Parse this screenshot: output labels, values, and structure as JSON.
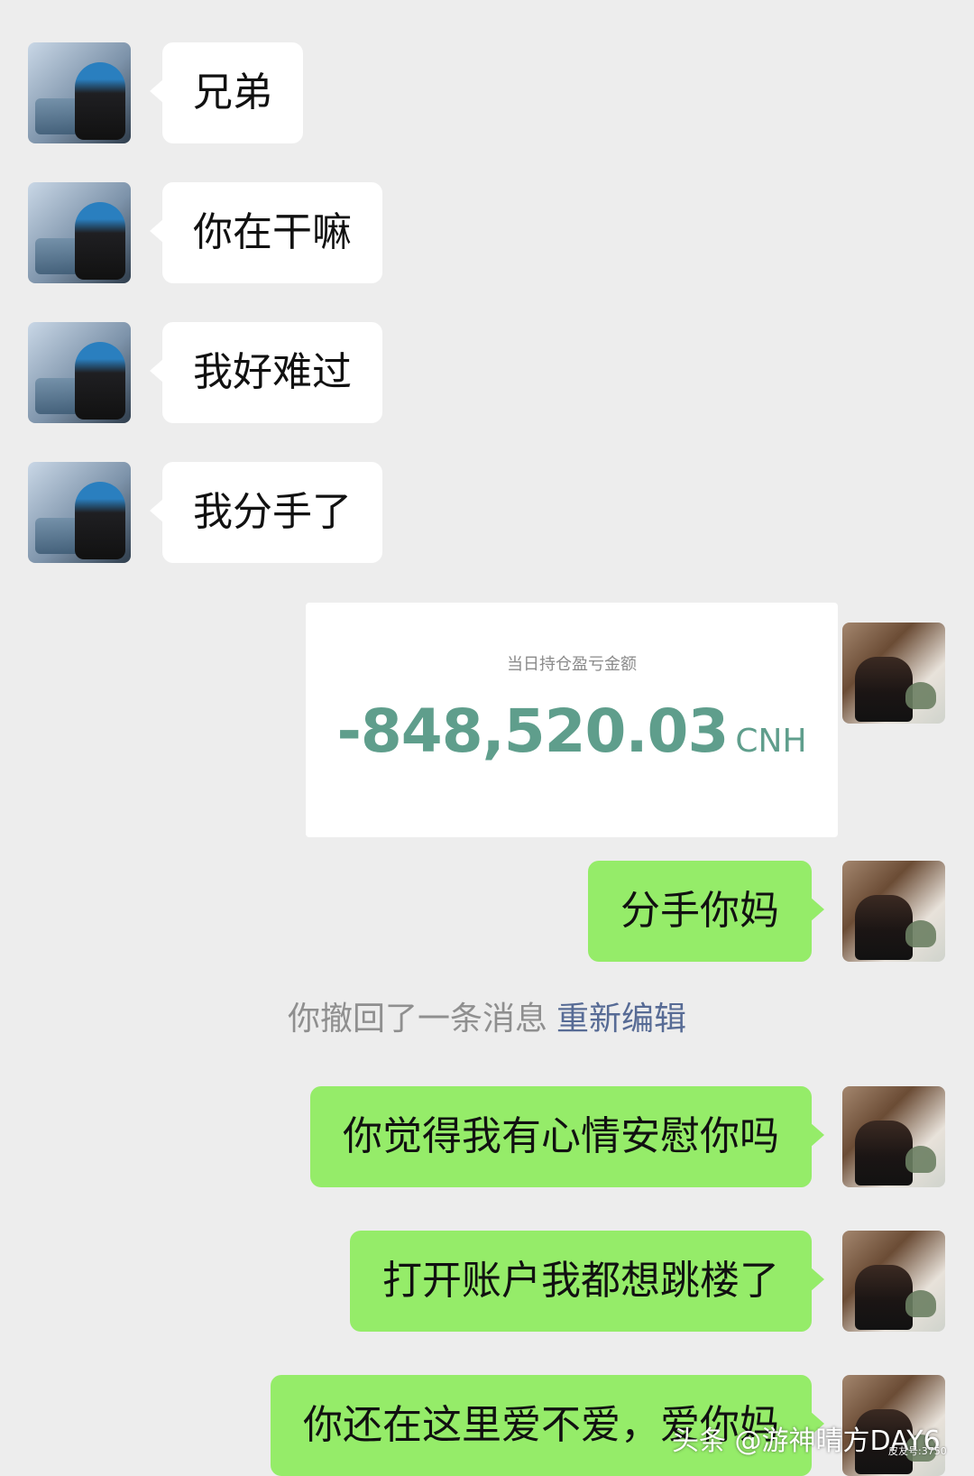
{
  "messages_left": [
    {
      "text": "兄弟"
    },
    {
      "text": "你在干嘛"
    },
    {
      "text": "我好难过"
    },
    {
      "text": "我分手了"
    }
  ],
  "pnl_card": {
    "label": "当日持仓盈亏金额",
    "amount": "-848,520.03",
    "currency": "CNH",
    "accent_color": "#5f9e8c"
  },
  "messages_right": [
    {
      "text": "分手你妈"
    },
    {
      "text": "你觉得我有心情安慰你吗"
    },
    {
      "text": "打开账户我都想跳楼了"
    },
    {
      "text": "你还在这里爱不爱，爱你妈"
    }
  ],
  "recall_notice": {
    "text": "你撤回了一条消息",
    "action_label": "重新编辑"
  },
  "watermark": {
    "text": "头条 @游神晴方DAY6",
    "small_text": "皮友号:3750"
  },
  "colors": {
    "background": "#ededed",
    "incoming_bubble": "#ffffff",
    "outgoing_bubble": "#95ec69",
    "link": "#576b95"
  }
}
